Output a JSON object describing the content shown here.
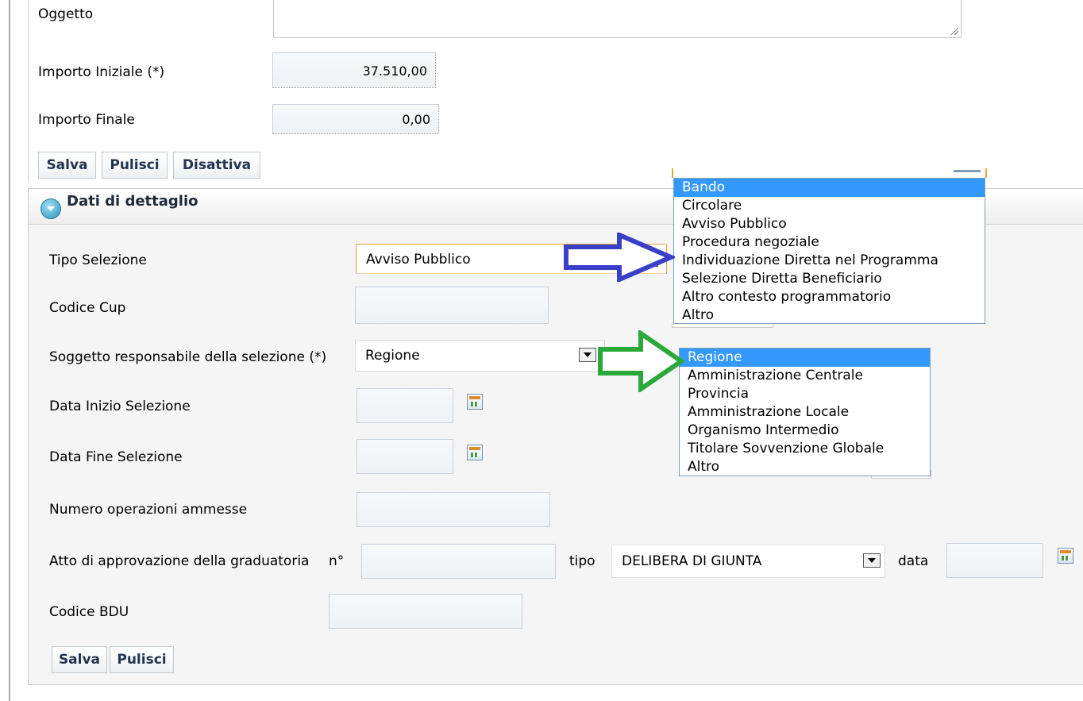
{
  "top": {
    "oggetto_label": "Oggetto",
    "importo_iniziale_label": "Importo Iniziale (*)",
    "importo_iniziale_value": "37.510,00",
    "importo_finale_label": "Importo Finale",
    "importo_finale_value": "0,00",
    "buttons": {
      "salva": "Salva",
      "pulisci": "Pulisci",
      "disattiva": "Disattiva"
    }
  },
  "section": {
    "title": "Dati di dettaglio",
    "tipo_selezione_label": "Tipo Selezione",
    "tipo_selezione_value": "Avviso Pubblico",
    "codice_cup_label": "Codice Cup",
    "soggetto_label": "Soggetto responsabile della selezione (*)",
    "soggetto_value": "Regione",
    "data_inizio_label": "Data Inizio Selezione",
    "data_fine_label": "Data Fine Selezione",
    "numero_operazioni_label": "Numero operazioni ammesse",
    "atto_label": "Atto di approvazione della graduatoria",
    "atto_n_label": "n°",
    "atto_tipo_label": "tipo",
    "atto_tipo_value": "DELIBERA DI GIUNTA",
    "atto_data_label": "data",
    "codice_bdu_label": "Codice BDU",
    "buttons": {
      "salva": "Salva",
      "pulisci": "Pulisci"
    }
  },
  "tipo_selezione_options": [
    "Bando",
    "Circolare",
    "Avviso Pubblico",
    "Procedura negoziale",
    "Individuazione Diretta nel Programma",
    "Selezione Diretta Beneficiario",
    "Altro contesto programmatorio",
    "Altro"
  ],
  "soggetto_options": [
    "Regione",
    "Amministrazione Centrale",
    "Provincia",
    "Amministrazione Locale",
    "Organismo Intermedio",
    "Titolare Sovvenzione Globale",
    "Altro"
  ],
  "colors": {
    "selection_highlight": "#3399ff",
    "arrow_blue": "#3a3fc8",
    "arrow_green": "#2aa83a",
    "button_text": "#23344f"
  }
}
